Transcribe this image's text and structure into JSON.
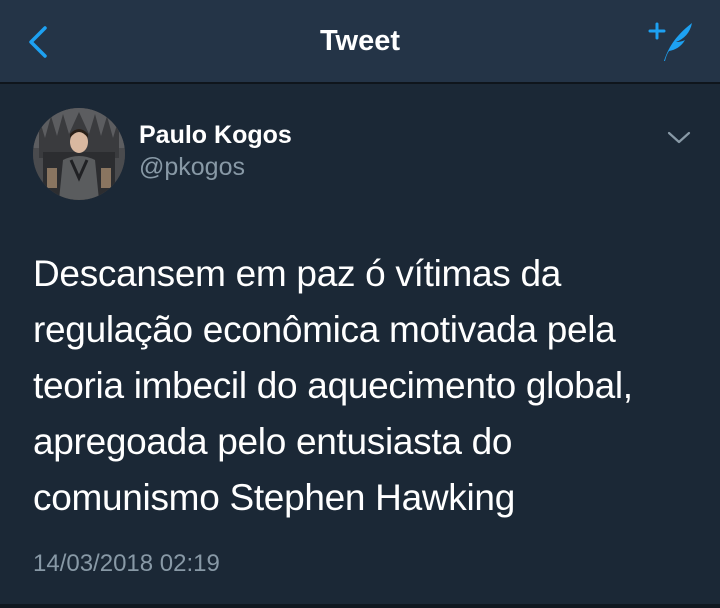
{
  "nav": {
    "title": "Tweet",
    "back_icon": "chevron-left-icon",
    "compose_icon": "compose-tweet-icon",
    "accent_color": "#1da1f2"
  },
  "tweet": {
    "author_name": "Paulo Kogos",
    "author_handle": "@pkogos",
    "text": "Descansem em paz ó vítimas da\nregulação econômica motivada pela\nteoria imbecil do aquecimento global,\napregoada pelo entusiasta do\ncomunismo Stephen Hawking",
    "timestamp": "14/03/2018 02:19",
    "menu_icon": "chevron-down-icon"
  },
  "colors": {
    "nav_background": "#243447",
    "background": "#1b2836",
    "text_primary": "#ffffff",
    "text_secondary": "#8899a6"
  }
}
